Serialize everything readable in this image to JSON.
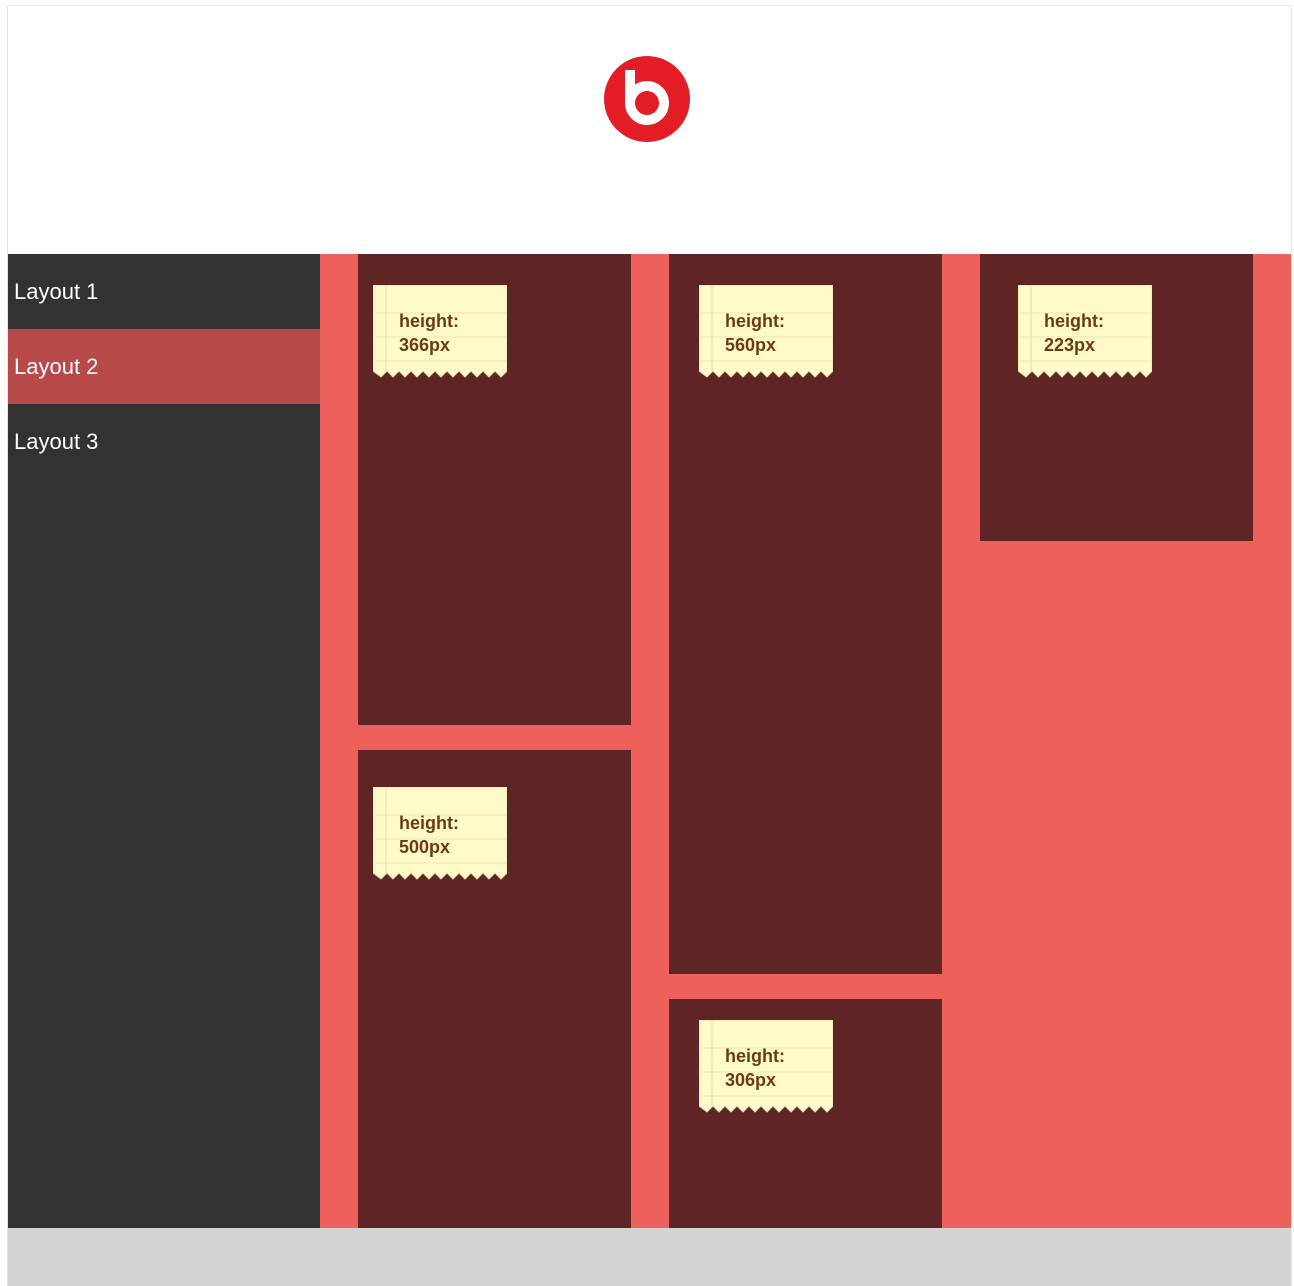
{
  "header": {
    "logo_icon": "beats-logo-icon",
    "logo_color": "#e31d25"
  },
  "sidebar": {
    "items": [
      {
        "label": "Layout 1",
        "active": false
      },
      {
        "label": "Layout 2",
        "active": true
      },
      {
        "label": "Layout 3",
        "active": false
      }
    ]
  },
  "cards": [
    {
      "label": "height:",
      "value": "366px"
    },
    {
      "label": "height:",
      "value": "500px"
    },
    {
      "label": "height:",
      "value": "560px"
    },
    {
      "label": "height:",
      "value": "306px"
    },
    {
      "label": "height:",
      "value": "223px"
    }
  ],
  "colors": {
    "sidebar_bg": "#323232",
    "active_item_bg": "#b74a48",
    "content_bg": "#ee605b",
    "card_bg": "#5f2424",
    "note_bg": "#fffbc8",
    "note_text": "#6e3a12",
    "footer_bg": "#d4d4d4"
  }
}
